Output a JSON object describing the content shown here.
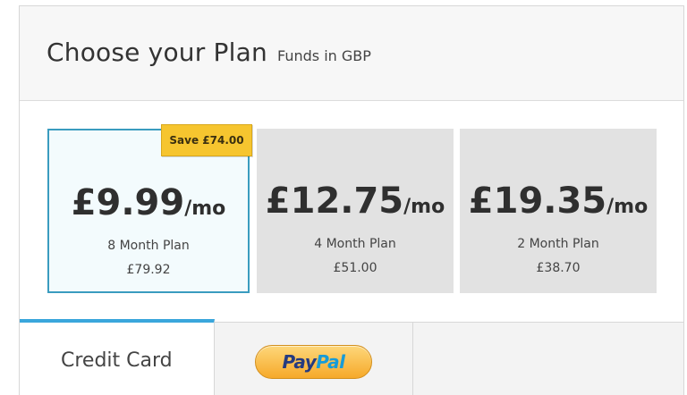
{
  "header": {
    "title": "Choose your Plan",
    "subtitle": "Funds in GBP"
  },
  "plans": [
    {
      "price": "£9.99",
      "per": "/mo",
      "name": "8 Month Plan",
      "total": "£79.92",
      "selected": true,
      "badge": "Save £74.00"
    },
    {
      "price": "£12.75",
      "per": "/mo",
      "name": "4 Month Plan",
      "total": "£51.00",
      "selected": false
    },
    {
      "price": "£19.35",
      "per": "/mo",
      "name": "2 Month Plan",
      "total": "£38.70",
      "selected": false
    }
  ],
  "payment_tabs": {
    "credit_card": "Credit Card",
    "paypal_pay": "Pay",
    "paypal_pal": "Pal",
    "active": "Credit Card"
  },
  "colors": {
    "selected_border": "#3a9cbf",
    "badge": "#f6c52f",
    "active_tab_accent": "#3aa6dc"
  }
}
